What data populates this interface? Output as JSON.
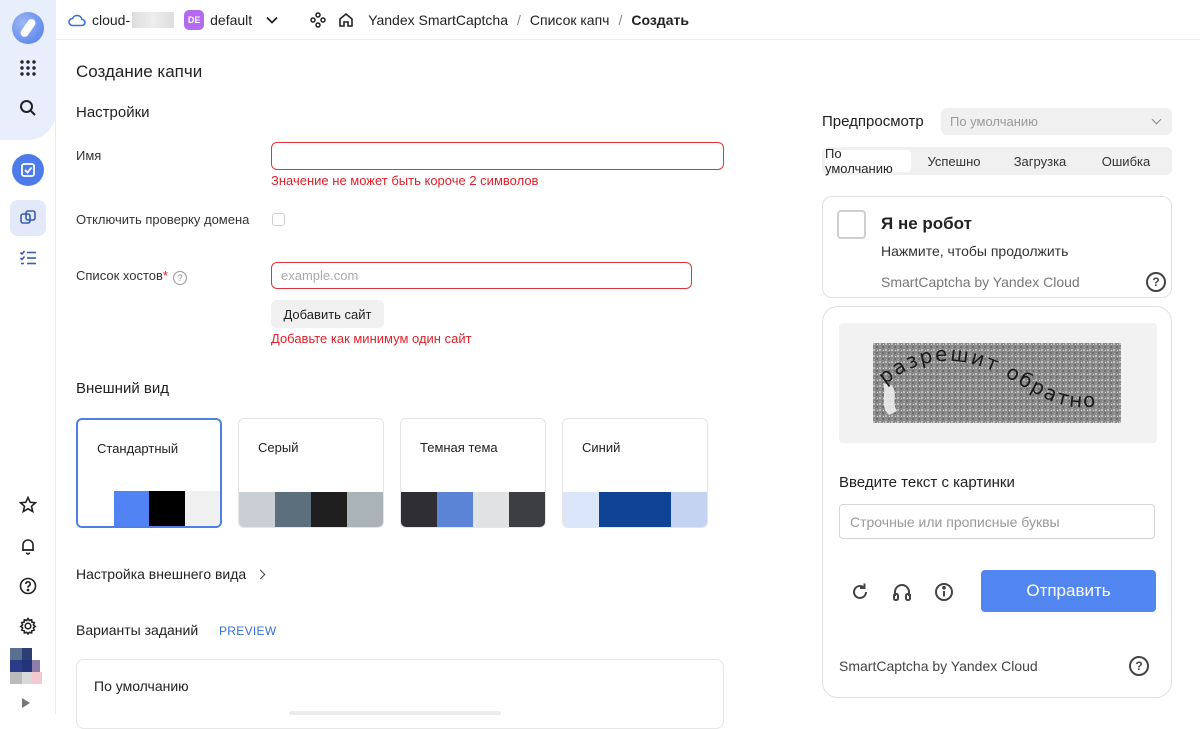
{
  "header": {
    "cloud_name": "cloud-",
    "folder_badge": "DE",
    "folder_name": "default",
    "breadcrumbs": [
      "Yandex SmartCaptcha",
      "Список капч",
      "Создать"
    ]
  },
  "form": {
    "title": "Создание капчи",
    "settings_title": "Настройки",
    "name_label": "Имя",
    "name_value": "",
    "name_error": "Значение не может быть короче 2 символов",
    "domain_check_label": "Отключить проверку домена",
    "hosts_label": "Список хостов",
    "required_mark": "*",
    "help_glyph": "?",
    "hosts_placeholder": "example.com",
    "add_site_button": "Добавить сайт",
    "hosts_error": "Добавьте как минимум один сайт",
    "appearance_title": "Внешний вид",
    "themes": [
      {
        "name": "Стандартный",
        "colors": [
          "#ffffff",
          "#5283f5",
          "#000000",
          "#f0f0f0"
        ],
        "selected": true
      },
      {
        "name": "Серый",
        "colors": [
          "#c9cfd4",
          "#5b6f7c",
          "#1f1f20",
          "#aab3b7"
        ],
        "selected": false
      },
      {
        "name": "Темная тема",
        "colors": [
          "#2f2f33",
          "#5b83d6",
          "#e1e2e4",
          "#3d3e42"
        ],
        "selected": false
      },
      {
        "name": "Синий",
        "colors": [
          "#dbe6fb",
          "#0f4396",
          "#0f4396",
          "#c3d3f1"
        ],
        "selected": false
      }
    ],
    "appearance_settings": "Настройка внешнего вида",
    "tasks_title": "Варианты заданий",
    "tasks_tag": "PREVIEW",
    "default_task": "По умолчанию"
  },
  "preview": {
    "label": "Предпросмотр",
    "select_placeholder": "По умолчанию",
    "tabs": [
      "По умолчанию",
      "Успешно",
      "Загрузка",
      "Ошибка"
    ],
    "active_tab": 0,
    "checkbox_title": "Я не робот",
    "checkbox_subtitle": "Нажмите, чтобы продолжить",
    "brand": "SmartCaptcha by Yandex Cloud",
    "help_glyph": "?",
    "captcha_image_text": "разрешит обратно",
    "captcha_prompt": "Введите текст с картинки",
    "captcha_placeholder": "Строчные или прописные буквы",
    "submit_button": "Отправить"
  },
  "colors": {
    "accent": "#5286f0",
    "error": "#e0202a",
    "selected_border": "#4f7fe6"
  }
}
